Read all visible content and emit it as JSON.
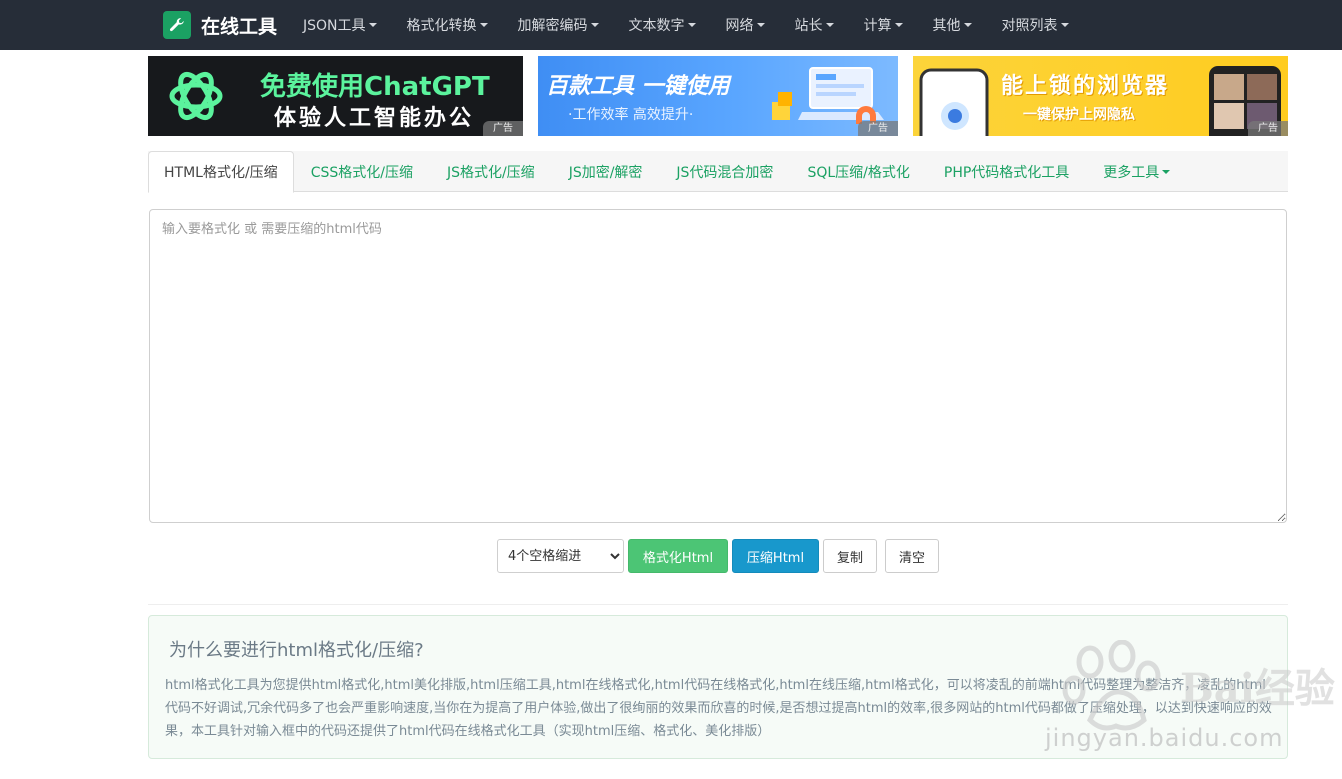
{
  "brand": {
    "name": "在线工具",
    "icon": "wrench-icon"
  },
  "nav": {
    "items": [
      {
        "label": "JSON工具",
        "id": "json"
      },
      {
        "label": "格式化转换",
        "id": "format"
      },
      {
        "label": "加解密编码",
        "id": "crypto"
      },
      {
        "label": "文本数字",
        "id": "text"
      },
      {
        "label": "网络",
        "id": "network"
      },
      {
        "label": "站长",
        "id": "webmaster"
      },
      {
        "label": "计算",
        "id": "calc"
      },
      {
        "label": "其他",
        "id": "other"
      },
      {
        "label": "对照列表",
        "id": "tables"
      }
    ]
  },
  "ads": [
    {
      "line1": "免费使用ChatGPT",
      "line2": "体验人工智能办公",
      "tag": "广告"
    },
    {
      "line1": "百款工具 一键使用",
      "line2": "·工作效率 高效提升·",
      "tag": "广告"
    },
    {
      "line1": "能上锁的浏览器",
      "line2": "一键保护上网隐私",
      "tag": "广告"
    }
  ],
  "tabs": [
    {
      "label": "HTML格式化/压缩",
      "active": true
    },
    {
      "label": "CSS格式化/压缩"
    },
    {
      "label": "JS格式化/压缩"
    },
    {
      "label": "JS加密/解密"
    },
    {
      "label": "JS代码混合加密"
    },
    {
      "label": "SQL压缩/格式化"
    },
    {
      "label": "PHP代码格式化工具"
    },
    {
      "label": "更多工具",
      "dropdown": true
    }
  ],
  "editor": {
    "placeholder": "输入要格式化 或 需要压缩的html代码",
    "value": ""
  },
  "controls": {
    "indent_selected": "4个空格缩进",
    "format_label": "格式化Html",
    "compress_label": "压缩Html",
    "copy_label": "复制",
    "clear_label": "清空"
  },
  "info": {
    "title": "为什么要进行html格式化/压缩?",
    "body": "html格式化工具为您提供html格式化,html美化排版,html压缩工具,html在线格式化,html代码在线格式化,html在线压缩,html格式化，可以将凌乱的前端html代码整理为整洁齐，凌乱的html代码不好调试,冗余代码多了也会严重影响速度,当你在为提高了用户体验,做出了很绚丽的效果而欣喜的时候,是否想过提高html的效率,很多网站的html代码都做了压缩处理，以达到快速响应的效果，本工具针对输入框中的代码还提供了html代码在线格式化工具（实现html压缩、格式化、美化排版）"
  },
  "watermark": {
    "text": "Bai经验",
    "url": "jingyan.baidu.com"
  },
  "colors": {
    "navbar": "#262d38",
    "accent": "#1ba163",
    "green_btn": "#4cc575",
    "blue_btn": "#1898cc"
  }
}
